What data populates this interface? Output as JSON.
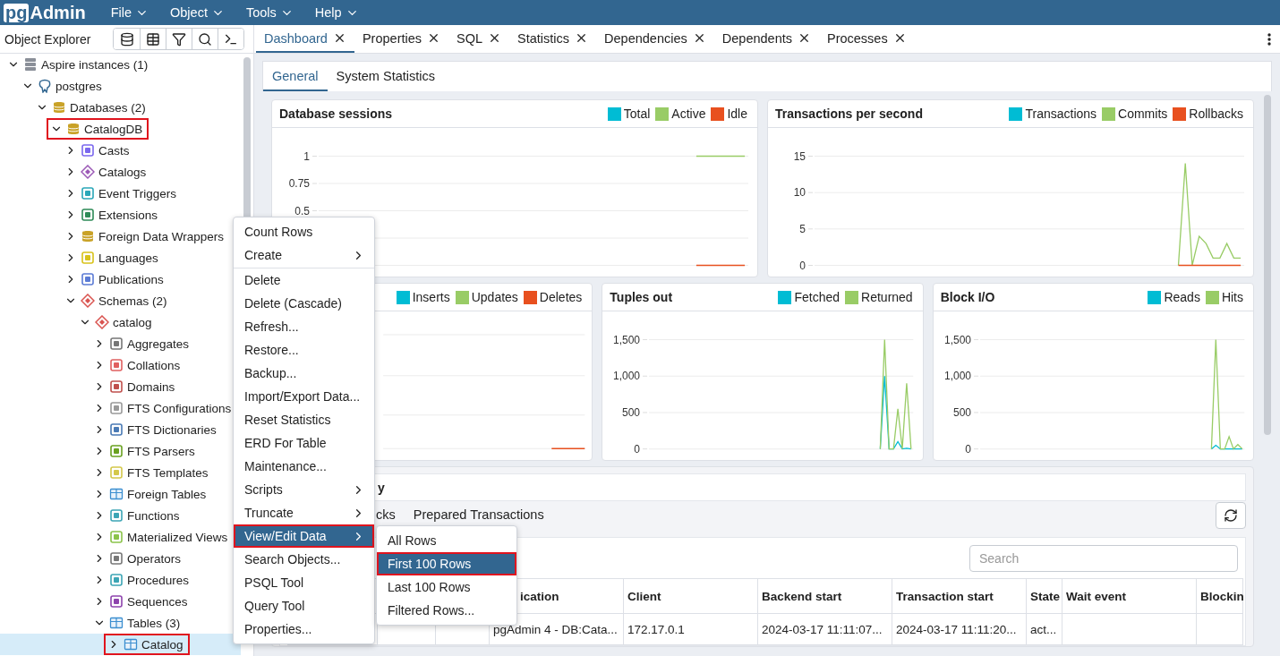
{
  "app": {
    "logo_prefix": "pg",
    "logo_name": "Admin",
    "menus": [
      "File",
      "Object",
      "Tools",
      "Help"
    ]
  },
  "object_explorer": {
    "title": "Object Explorer",
    "tree": [
      {
        "label": "Aspire instances (1)",
        "kind": "servers",
        "expanded": true,
        "selected": false,
        "annotated": false,
        "children": [
          {
            "label": "postgres",
            "kind": "server",
            "expanded": true,
            "selected": false,
            "annotated": false,
            "children": [
              {
                "label": "Databases (2)",
                "kind": "databases",
                "expanded": true,
                "selected": false,
                "annotated": false,
                "children": [
                  {
                    "label": "CatalogDB",
                    "kind": "database",
                    "expanded": true,
                    "selected": false,
                    "annotated": true,
                    "children": [
                      {
                        "label": "Casts",
                        "kind": "cast",
                        "expanded": false,
                        "selected": false,
                        "annotated": false
                      },
                      {
                        "label": "Catalogs",
                        "kind": "catalog",
                        "expanded": false,
                        "selected": false,
                        "annotated": false
                      },
                      {
                        "label": "Event Triggers",
                        "kind": "trigger",
                        "expanded": false,
                        "selected": false,
                        "annotated": false
                      },
                      {
                        "label": "Extensions",
                        "kind": "extension",
                        "expanded": false,
                        "selected": false,
                        "annotated": false
                      },
                      {
                        "label": "Foreign Data Wrappers",
                        "kind": "fdw",
                        "expanded": false,
                        "selected": false,
                        "annotated": false
                      },
                      {
                        "label": "Languages",
                        "kind": "language",
                        "expanded": false,
                        "selected": false,
                        "annotated": false
                      },
                      {
                        "label": "Publications",
                        "kind": "publication",
                        "expanded": false,
                        "selected": false,
                        "annotated": false
                      },
                      {
                        "label": "Schemas (2)",
                        "kind": "schemas",
                        "expanded": true,
                        "selected": false,
                        "annotated": false,
                        "children": [
                          {
                            "label": "catalog",
                            "kind": "schema",
                            "expanded": true,
                            "selected": false,
                            "annotated": false,
                            "children": [
                              {
                                "label": "Aggregates",
                                "kind": "aggregate",
                                "expanded": false,
                                "selected": false,
                                "annotated": false
                              },
                              {
                                "label": "Collations",
                                "kind": "collation",
                                "expanded": false,
                                "selected": false,
                                "annotated": false
                              },
                              {
                                "label": "Domains",
                                "kind": "domain",
                                "expanded": false,
                                "selected": false,
                                "annotated": false
                              },
                              {
                                "label": "FTS Configurations",
                                "kind": "fts_config",
                                "expanded": false,
                                "selected": false,
                                "annotated": false
                              },
                              {
                                "label": "FTS Dictionaries",
                                "kind": "fts_dict",
                                "expanded": false,
                                "selected": false,
                                "annotated": false
                              },
                              {
                                "label": "FTS Parsers",
                                "kind": "fts_parser",
                                "expanded": false,
                                "selected": false,
                                "annotated": false
                              },
                              {
                                "label": "FTS Templates",
                                "kind": "fts_template",
                                "expanded": false,
                                "selected": false,
                                "annotated": false
                              },
                              {
                                "label": "Foreign Tables",
                                "kind": "foreign_table",
                                "expanded": false,
                                "selected": false,
                                "annotated": false
                              },
                              {
                                "label": "Functions",
                                "kind": "function",
                                "expanded": false,
                                "selected": false,
                                "annotated": false
                              },
                              {
                                "label": "Materialized Views",
                                "kind": "matview",
                                "expanded": false,
                                "selected": false,
                                "annotated": false
                              },
                              {
                                "label": "Operators",
                                "kind": "operator",
                                "expanded": false,
                                "selected": false,
                                "annotated": false
                              },
                              {
                                "label": "Procedures",
                                "kind": "procedure",
                                "expanded": false,
                                "selected": false,
                                "annotated": false
                              },
                              {
                                "label": "Sequences",
                                "kind": "sequence",
                                "expanded": false,
                                "selected": false,
                                "annotated": false
                              },
                              {
                                "label": "Tables (3)",
                                "kind": "tables",
                                "expanded": true,
                                "selected": false,
                                "annotated": false,
                                "children": [
                                  {
                                    "label": "Catalog",
                                    "kind": "table",
                                    "expanded": false,
                                    "selected": true,
                                    "annotated": true
                                  }
                                ]
                              }
                            ]
                          }
                        ]
                      }
                    ]
                  }
                ]
              }
            ]
          }
        ]
      }
    ]
  },
  "tabs": [
    {
      "label": "Dashboard",
      "selected": true
    },
    {
      "label": "Properties",
      "selected": false
    },
    {
      "label": "SQL",
      "selected": false
    },
    {
      "label": "Statistics",
      "selected": false
    },
    {
      "label": "Dependencies",
      "selected": false
    },
    {
      "label": "Dependents",
      "selected": false
    },
    {
      "label": "Processes",
      "selected": false
    }
  ],
  "dashboard": {
    "subtabs": [
      {
        "label": "General",
        "selected": true
      },
      {
        "label": "System Statistics",
        "selected": false
      }
    ],
    "chart_rows": [
      {
        "charts": [
          {
            "kind": "chart",
            "chart_data": {
              "type": "line",
              "title": "Database sessions",
              "categories": [
                null,
                null,
                null,
                null,
                null,
                null,
                null,
                null,
                null,
                null,
                null,
                null,
                null,
                null,
                null,
                null,
                null,
                null,
                null,
                null,
                null,
                null,
                null,
                null,
                null,
                null,
                null,
                null,
                null,
                null,
                null,
                null,
                null,
                null,
                null,
                null,
                null,
                null,
                null,
                null,
                null,
                null,
                null,
                null,
                null,
                null,
                null,
                null,
                null,
                null,
                null,
                null,
                null,
                null,
                null,
                null,
                null,
                null,
                null,
                null,
                null,
                null
              ],
              "ylim": [
                0,
                1
              ],
              "grid": true,
              "yticks": [
                0.5,
                0.75,
                1
              ],
              "series": [
                {
                  "name": "Total",
                  "color": "#00bcd4",
                  "values": [
                    null,
                    null,
                    null,
                    null,
                    null,
                    null,
                    null,
                    null,
                    null,
                    null,
                    null,
                    null,
                    null,
                    null,
                    null,
                    null,
                    null,
                    null,
                    null,
                    null,
                    null,
                    null,
                    null,
                    null,
                    null,
                    null,
                    null,
                    null,
                    null,
                    null,
                    null,
                    null,
                    null,
                    null,
                    null,
                    null,
                    null,
                    null,
                    null,
                    null,
                    null,
                    null,
                    null,
                    null,
                    null,
                    null,
                    null,
                    null,
                    null,
                    null,
                    null,
                    null,
                    null,
                    null,
                    null,
                    null,
                    null,
                    null,
                    null,
                    null,
                    null,
                    null
                  ]
                },
                {
                  "name": "Active",
                  "color": "#99cc66",
                  "values": [
                    null,
                    null,
                    null,
                    null,
                    null,
                    null,
                    null,
                    null,
                    null,
                    null,
                    null,
                    null,
                    null,
                    null,
                    null,
                    null,
                    null,
                    null,
                    null,
                    null,
                    null,
                    null,
                    null,
                    null,
                    null,
                    null,
                    null,
                    null,
                    null,
                    null,
                    null,
                    null,
                    null,
                    null,
                    null,
                    null,
                    null,
                    null,
                    null,
                    null,
                    null,
                    null,
                    null,
                    null,
                    null,
                    null,
                    null,
                    null,
                    null,
                    null,
                    null,
                    null,
                    null,
                    null,
                    1,
                    1,
                    1,
                    1,
                    1,
                    1,
                    1,
                    1
                  ]
                },
                {
                  "name": "Idle",
                  "color": "#e8501f",
                  "values": [
                    null,
                    null,
                    null,
                    null,
                    null,
                    null,
                    null,
                    null,
                    null,
                    null,
                    null,
                    null,
                    null,
                    null,
                    null,
                    null,
                    null,
                    null,
                    null,
                    null,
                    null,
                    null,
                    null,
                    null,
                    null,
                    null,
                    null,
                    null,
                    null,
                    null,
                    null,
                    null,
                    null,
                    null,
                    null,
                    null,
                    null,
                    null,
                    null,
                    null,
                    null,
                    null,
                    null,
                    null,
                    null,
                    null,
                    null,
                    null,
                    null,
                    null,
                    null,
                    null,
                    null,
                    null,
                    0,
                    0,
                    0,
                    0,
                    0,
                    0,
                    0,
                    0
                  ]
                }
              ]
            }
          },
          {
            "kind": "chart",
            "chart_data": {
              "type": "line",
              "title": "Transactions per second",
              "categories": [
                null,
                null,
                null,
                null,
                null,
                null,
                null,
                null,
                null,
                null,
                null,
                null,
                null,
                null,
                null,
                null,
                null,
                null,
                null,
                null,
                null,
                null,
                null,
                null,
                null,
                null,
                null,
                null,
                null,
                null,
                null,
                null,
                null,
                null,
                null,
                null,
                null,
                null,
                null,
                null,
                null,
                null,
                null,
                null,
                null,
                null,
                null,
                null,
                null,
                null,
                null,
                null,
                null,
                null,
                null,
                null,
                null,
                null,
                null,
                null,
                null,
                null
              ],
              "ylim": [
                0,
                15
              ],
              "grid": true,
              "yticks": [
                0,
                5,
                10,
                15
              ],
              "series": [
                {
                  "name": "Transactions",
                  "color": "#00bcd4",
                  "values": [
                    null,
                    null,
                    null,
                    null,
                    null,
                    null,
                    null,
                    null,
                    null,
                    null,
                    null,
                    null,
                    null,
                    null,
                    null,
                    null,
                    null,
                    null,
                    null,
                    null,
                    null,
                    null,
                    null,
                    null,
                    null,
                    null,
                    null,
                    null,
                    null,
                    null,
                    null,
                    null,
                    null,
                    null,
                    null,
                    null,
                    null,
                    null,
                    null,
                    null,
                    null,
                    null,
                    null,
                    null,
                    null,
                    null,
                    null,
                    null,
                    null,
                    null,
                    null,
                    null,
                    null,
                    null,
                    null,
                    null,
                    null,
                    null,
                    null,
                    null,
                    null,
                    null
                  ]
                },
                {
                  "name": "Commits",
                  "color": "#99cc66",
                  "values": [
                    null,
                    null,
                    null,
                    null,
                    null,
                    null,
                    null,
                    null,
                    null,
                    null,
                    null,
                    null,
                    null,
                    null,
                    null,
                    null,
                    null,
                    null,
                    null,
                    null,
                    null,
                    null,
                    null,
                    null,
                    null,
                    null,
                    null,
                    null,
                    null,
                    null,
                    null,
                    null,
                    null,
                    null,
                    null,
                    null,
                    null,
                    null,
                    null,
                    null,
                    null,
                    null,
                    null,
                    null,
                    null,
                    null,
                    null,
                    null,
                    null,
                    null,
                    null,
                    null,
                    0,
                    14,
                    0,
                    4,
                    3,
                    1,
                    1,
                    3,
                    1,
                    1
                  ]
                },
                {
                  "name": "Rollbacks",
                  "color": "#e8501f",
                  "values": [
                    null,
                    null,
                    null,
                    null,
                    null,
                    null,
                    null,
                    null,
                    null,
                    null,
                    null,
                    null,
                    null,
                    null,
                    null,
                    null,
                    null,
                    null,
                    null,
                    null,
                    null,
                    null,
                    null,
                    null,
                    null,
                    null,
                    null,
                    null,
                    null,
                    null,
                    null,
                    null,
                    null,
                    null,
                    null,
                    null,
                    null,
                    null,
                    null,
                    null,
                    null,
                    null,
                    null,
                    null,
                    null,
                    null,
                    null,
                    null,
                    null,
                    null,
                    null,
                    null,
                    0,
                    0,
                    0,
                    0,
                    0,
                    0,
                    0,
                    0,
                    0,
                    0
                  ]
                }
              ]
            }
          }
        ]
      },
      {
        "charts": [
          {
            "kind": "picture",
            "legend": [
              {
                "name": "Inserts",
                "color": "#00bcd4"
              },
              {
                "name": "Updates",
                "color": "#99cc66"
              },
              {
                "name": "Deletes",
                "color": "#e8501f"
              }
            ]
          },
          {
            "kind": "chart",
            "chart_data": {
              "type": "line",
              "title": "Tuples out",
              "categories": [
                null,
                null,
                null,
                null,
                null,
                null,
                null,
                null,
                null,
                null,
                null,
                null,
                null,
                null,
                null,
                null,
                null,
                null,
                null,
                null,
                null,
                null,
                null,
                null,
                null,
                null,
                null,
                null,
                null,
                null,
                null,
                null,
                null,
                null,
                null,
                null,
                null,
                null,
                null,
                null,
                null,
                null,
                null,
                null,
                null,
                null,
                null,
                null,
                null,
                null,
                null,
                null,
                null,
                null,
                null,
                null,
                null,
                null,
                null,
                null
              ],
              "ylim": [
                0,
                1500
              ],
              "grid": true,
              "yticks": [
                {
                  "value": 0,
                  "label": "0"
                },
                {
                  "value": 500,
                  "label": "500"
                },
                {
                  "value": 1000,
                  "label": "1,000"
                },
                {
                  "value": 1500,
                  "label": "1,500"
                }
              ],
              "series": [
                {
                  "name": "Fetched",
                  "color": "#00bcd4",
                  "values": [
                    null,
                    null,
                    null,
                    null,
                    null,
                    null,
                    null,
                    null,
                    null,
                    null,
                    null,
                    null,
                    null,
                    null,
                    null,
                    null,
                    null,
                    null,
                    null,
                    null,
                    null,
                    null,
                    null,
                    null,
                    null,
                    null,
                    null,
                    null,
                    null,
                    null,
                    null,
                    null,
                    null,
                    null,
                    null,
                    null,
                    null,
                    null,
                    null,
                    null,
                    null,
                    null,
                    null,
                    null,
                    null,
                    null,
                    null,
                    null,
                    null,
                    null,
                    null,
                    null,
                    0,
                    1000,
                    0,
                    0,
                    100,
                    0,
                    10,
                    0
                  ]
                },
                {
                  "name": "Returned",
                  "color": "#99cc66",
                  "values": [
                    null,
                    null,
                    null,
                    null,
                    null,
                    null,
                    null,
                    null,
                    null,
                    null,
                    null,
                    null,
                    null,
                    null,
                    null,
                    null,
                    null,
                    null,
                    null,
                    null,
                    null,
                    null,
                    null,
                    null,
                    null,
                    null,
                    null,
                    null,
                    null,
                    null,
                    null,
                    null,
                    null,
                    null,
                    null,
                    null,
                    null,
                    null,
                    null,
                    null,
                    null,
                    null,
                    null,
                    null,
                    null,
                    null,
                    null,
                    null,
                    null,
                    null,
                    null,
                    null,
                    0,
                    1500,
                    0,
                    0,
                    550,
                    0,
                    900,
                    0
                  ]
                }
              ]
            }
          },
          {
            "kind": "chart",
            "chart_data": {
              "type": "line",
              "title": "Block I/O",
              "categories": [
                null,
                null,
                null,
                null,
                null,
                null,
                null,
                null,
                null,
                null,
                null,
                null,
                null,
                null,
                null,
                null,
                null,
                null,
                null,
                null,
                null,
                null,
                null,
                null,
                null,
                null,
                null,
                null,
                null,
                null,
                null,
                null,
                null,
                null,
                null,
                null,
                null,
                null,
                null,
                null,
                null,
                null,
                null,
                null,
                null,
                null,
                null,
                null,
                null,
                null,
                null,
                null,
                null,
                null,
                null,
                null,
                null,
                null,
                null,
                null
              ],
              "ylim": [
                0,
                1500
              ],
              "grid": true,
              "yticks": [
                {
                  "value": 0,
                  "label": "0"
                },
                {
                  "value": 500,
                  "label": "500"
                },
                {
                  "value": 1000,
                  "label": "1,000"
                },
                {
                  "value": 1500,
                  "label": "1,500"
                }
              ],
              "series": [
                {
                  "name": "Reads",
                  "color": "#00bcd4",
                  "values": [
                    null,
                    null,
                    null,
                    null,
                    null,
                    null,
                    null,
                    null,
                    null,
                    null,
                    null,
                    null,
                    null,
                    null,
                    null,
                    null,
                    null,
                    null,
                    null,
                    null,
                    null,
                    null,
                    null,
                    null,
                    null,
                    null,
                    null,
                    null,
                    null,
                    null,
                    null,
                    null,
                    null,
                    null,
                    null,
                    null,
                    null,
                    null,
                    null,
                    null,
                    null,
                    null,
                    null,
                    null,
                    null,
                    null,
                    null,
                    null,
                    null,
                    null,
                    null,
                    null,
                    0,
                    50,
                    0,
                    0,
                    0,
                    0,
                    0,
                    0
                  ]
                },
                {
                  "name": "Hits",
                  "color": "#99cc66",
                  "values": [
                    null,
                    null,
                    null,
                    null,
                    null,
                    null,
                    null,
                    null,
                    null,
                    null,
                    null,
                    null,
                    null,
                    null,
                    null,
                    null,
                    null,
                    null,
                    null,
                    null,
                    null,
                    null,
                    null,
                    null,
                    null,
                    null,
                    null,
                    null,
                    null,
                    null,
                    null,
                    null,
                    null,
                    null,
                    null,
                    null,
                    null,
                    null,
                    null,
                    null,
                    null,
                    null,
                    null,
                    null,
                    null,
                    null,
                    null,
                    null,
                    null,
                    null,
                    null,
                    null,
                    0,
                    1500,
                    0,
                    0,
                    170,
                    0,
                    60,
                    0
                  ]
                }
              ]
            }
          }
        ]
      }
    ],
    "server_activity": {
      "title": "y",
      "tabs": [
        {
          "label": "cks",
          "selected": false
        },
        {
          "label": "Prepared Transactions",
          "selected": false
        }
      ],
      "search": {
        "placeholder": "Search"
      },
      "columns": [
        "ication",
        "Client",
        "Backend start",
        "Transaction start",
        "State",
        "Wait event",
        "Blockin"
      ],
      "rows": [
        {
          "application": "pgAdmin 4 - DB:Cata...",
          "client": "172.17.0.1",
          "backend_start": "2024-03-17 11:11:07...",
          "transaction_start": "2024-03-17 11:11:20...",
          "state": "act..."
        }
      ]
    }
  },
  "context_menu": {
    "items": [
      {
        "kind": "action",
        "label": "Count Rows",
        "selected": false,
        "annotated": false
      },
      {
        "kind": "submenu",
        "label": "Create",
        "selected": false,
        "annotated": false
      },
      {
        "kind": "separator"
      },
      {
        "kind": "action",
        "label": "Delete",
        "selected": false,
        "annotated": false
      },
      {
        "kind": "action",
        "label": "Delete (Cascade)",
        "selected": false,
        "annotated": false
      },
      {
        "kind": "action",
        "label": "Refresh...",
        "selected": false,
        "annotated": false
      },
      {
        "kind": "action",
        "label": "Restore...",
        "selected": false,
        "annotated": false
      },
      {
        "kind": "action",
        "label": "Backup...",
        "selected": false,
        "annotated": false
      },
      {
        "kind": "action",
        "label": "Import/Export Data...",
        "selected": false,
        "annotated": false
      },
      {
        "kind": "action",
        "label": "Reset Statistics",
        "selected": false,
        "annotated": false
      },
      {
        "kind": "action",
        "label": "ERD For Table",
        "selected": false,
        "annotated": false
      },
      {
        "kind": "action",
        "label": "Maintenance...",
        "selected": false,
        "annotated": false
      },
      {
        "kind": "submenu",
        "label": "Scripts",
        "selected": false,
        "annotated": false
      },
      {
        "kind": "submenu",
        "label": "Truncate",
        "selected": false,
        "annotated": false
      },
      {
        "kind": "submenu",
        "label": "View/Edit Data",
        "selected": true,
        "annotated": true
      },
      {
        "kind": "action",
        "label": "Search Objects...",
        "selected": false,
        "annotated": false
      },
      {
        "kind": "action",
        "label": "PSQL Tool",
        "selected": false,
        "annotated": false
      },
      {
        "kind": "action",
        "label": "Query Tool",
        "selected": false,
        "annotated": false
      },
      {
        "kind": "action",
        "label": "Properties...",
        "selected": false,
        "annotated": false
      }
    ]
  },
  "submenu": {
    "items": [
      {
        "kind": "action",
        "label": "All Rows",
        "selected": false,
        "annotated": false
      },
      {
        "kind": "action",
        "label": "First 100 Rows",
        "selected": true,
        "annotated": true
      },
      {
        "kind": "action",
        "label": "Last 100 Rows",
        "selected": false,
        "annotated": false
      },
      {
        "kind": "action",
        "label": "Filtered Rows...",
        "selected": false,
        "annotated": false
      }
    ]
  }
}
